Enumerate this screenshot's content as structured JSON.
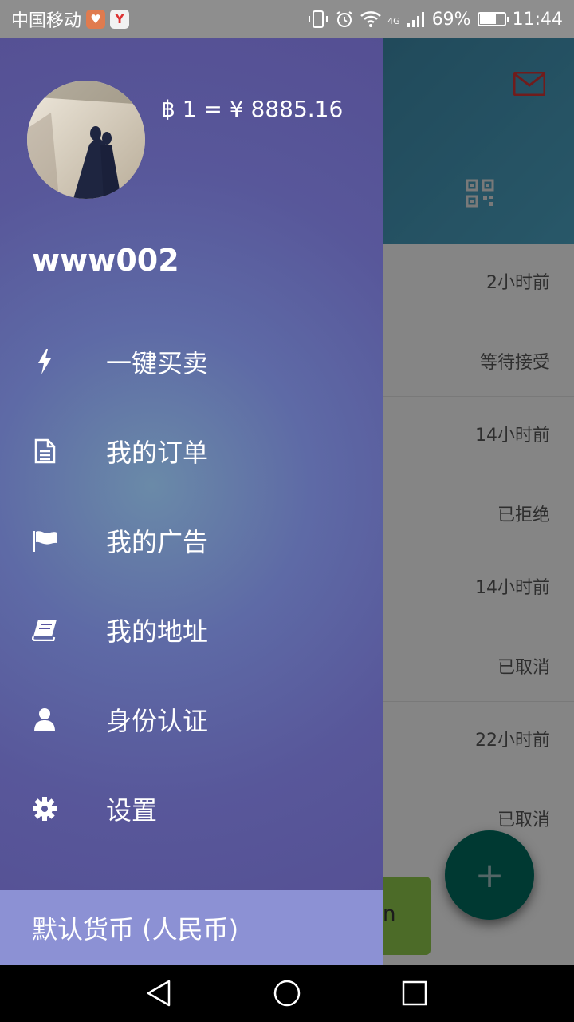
{
  "status_bar": {
    "carrier": "中国移动",
    "battery_percent": "69%",
    "battery_level": 0.69,
    "time": "11:44",
    "network": "4G"
  },
  "drawer": {
    "exchange_rate": "฿ 1 = ¥ 8885.16",
    "username": "www002",
    "menu": [
      {
        "label": "一键买卖",
        "icon": "bolt-icon"
      },
      {
        "label": "我的订单",
        "icon": "document-icon"
      },
      {
        "label": "我的广告",
        "icon": "flag-icon"
      },
      {
        "label": "我的地址",
        "icon": "book-icon"
      },
      {
        "label": "身份认证",
        "icon": "user-icon"
      },
      {
        "label": "设置",
        "icon": "gear-icon"
      }
    ],
    "footer_label": "默认货币 (人民币)"
  },
  "background_app": {
    "orders": [
      {
        "time": "2小时前",
        "status": "等待接受"
      },
      {
        "time": "14小时前",
        "status": "已拒绝"
      },
      {
        "time": "14小时前",
        "status": "已取消"
      },
      {
        "time": "22小时前",
        "status": "已取消"
      }
    ],
    "partial_button_text": "n",
    "fab_label": "+"
  },
  "colors": {
    "drawer_accent": "#544e92",
    "footer": "#8c91d4",
    "toolbar": "#2f6f8e",
    "fab": "#00695c",
    "mail_icon": "#a33"
  }
}
